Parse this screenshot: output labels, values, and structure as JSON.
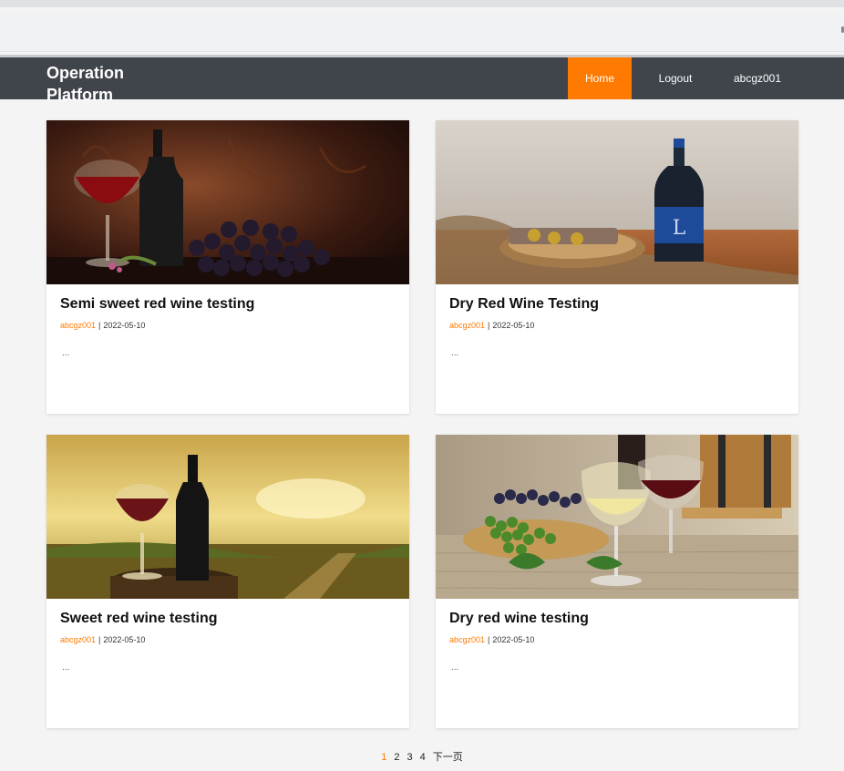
{
  "header": {
    "brand": "Operation Platform",
    "nav": {
      "home": "Home",
      "logout": "Logout",
      "user": "abcgz001"
    }
  },
  "cards": [
    {
      "title": "Semi sweet red wine testing",
      "author": "abcgz001",
      "date": "2022-05-10",
      "excerpt": "..."
    },
    {
      "title": "Dry Red Wine Testing",
      "author": "abcgz001",
      "date": "2022-05-10",
      "excerpt": "..."
    },
    {
      "title": "Sweet red wine testing",
      "author": "abcgz001",
      "date": "2022-05-10",
      "excerpt": "..."
    },
    {
      "title": "Dry red wine testing",
      "author": "abcgz001",
      "date": "2022-05-10",
      "excerpt": "..."
    }
  ],
  "pagination": {
    "pages": [
      "1",
      "2",
      "3",
      "4"
    ],
    "current": "1",
    "next": "下一页"
  },
  "colors": {
    "accent": "#ff7a00",
    "navbar": "#40444b"
  }
}
